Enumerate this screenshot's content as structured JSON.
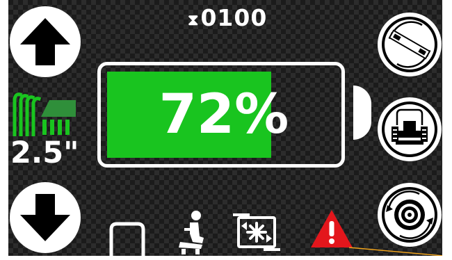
{
  "hour_meter": {
    "icon": "hourglass-icon",
    "value": "0100"
  },
  "battery": {
    "level_percent": 72,
    "label": "72%",
    "fill_color": "#19c41f"
  },
  "cut_height": {
    "value": "2.5\"",
    "icon": "grass-height-icon",
    "color": "#19c41f"
  },
  "buttons": {
    "up": "up-arrow-icon",
    "down": "down-arrow-icon",
    "blade_rotate": "blade-rotate-icon",
    "mower_front": "mower-front-icon",
    "wheel_rotate": "wheel-rotate-icon"
  },
  "status_icons": [
    "deck-icon",
    "seat-operator-icon",
    "pto-engage-icon",
    "warning-icon"
  ],
  "colors": {
    "accent_green": "#19c41f",
    "warning_red": "#e3161c",
    "callout_line": "#f2a51c"
  }
}
